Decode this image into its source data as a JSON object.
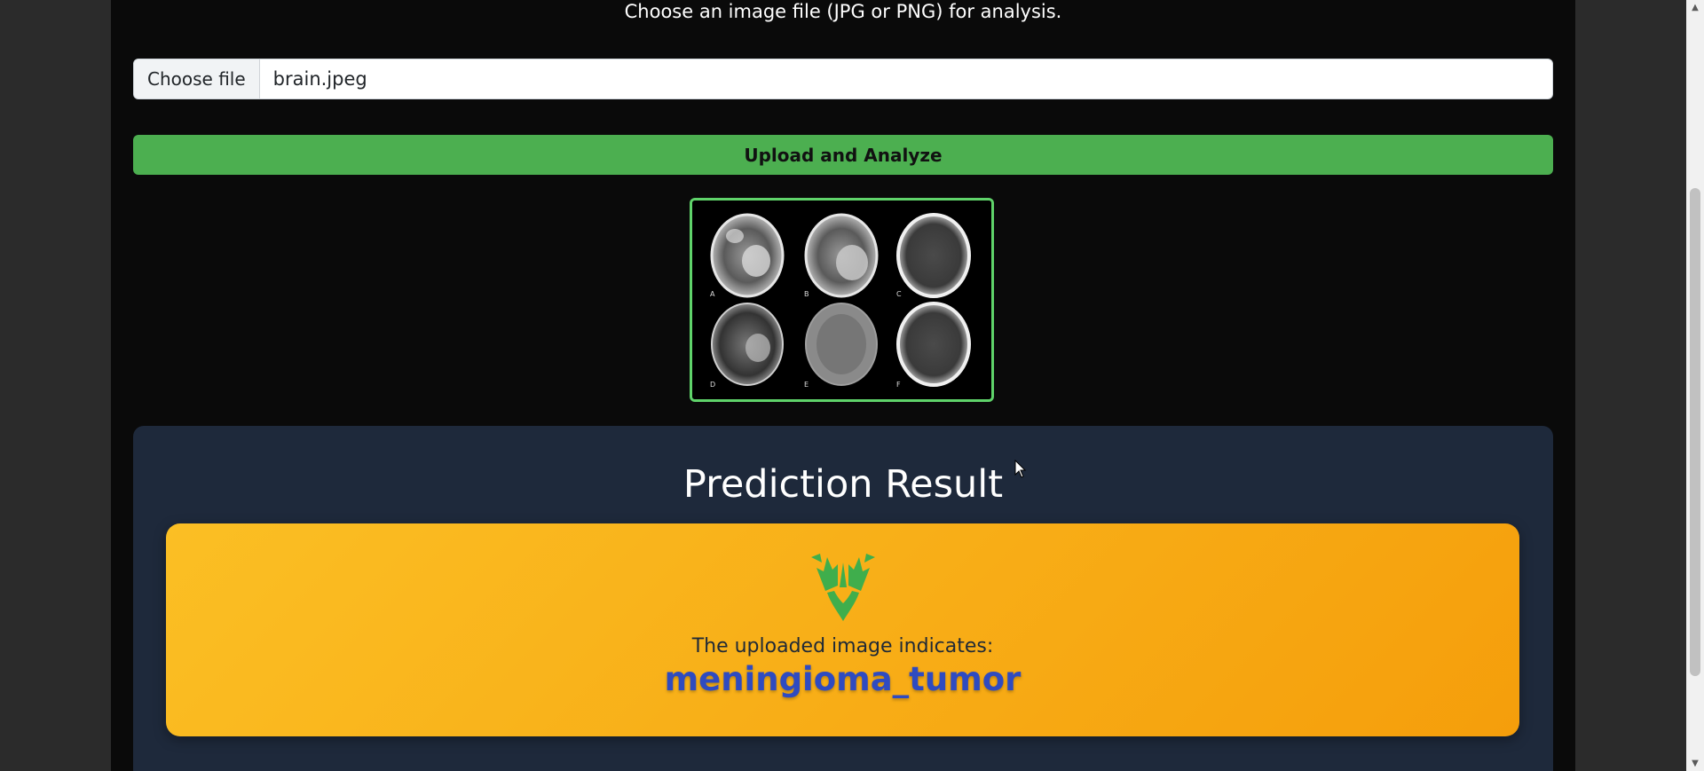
{
  "upload": {
    "instruction": "Choose an image file (JPG or PNG) for analysis.",
    "choose_file_label": "Choose file",
    "file_name": "brain.jpeg",
    "submit_label": "Upload and Analyze"
  },
  "preview": {
    "panel_letters": [
      "A",
      "B",
      "C",
      "D",
      "E",
      "F"
    ]
  },
  "result": {
    "title": "Prediction Result",
    "label": "The uploaded image indicates:",
    "value": "meningioma_tumor",
    "icon": "tree-icon"
  },
  "colors": {
    "accent_green": "#4caf50",
    "panel_dark": "#1e293b",
    "result_gradient_start": "#fbbf24",
    "result_gradient_end": "#f59e0b",
    "prediction_text": "#2f4bc0"
  }
}
